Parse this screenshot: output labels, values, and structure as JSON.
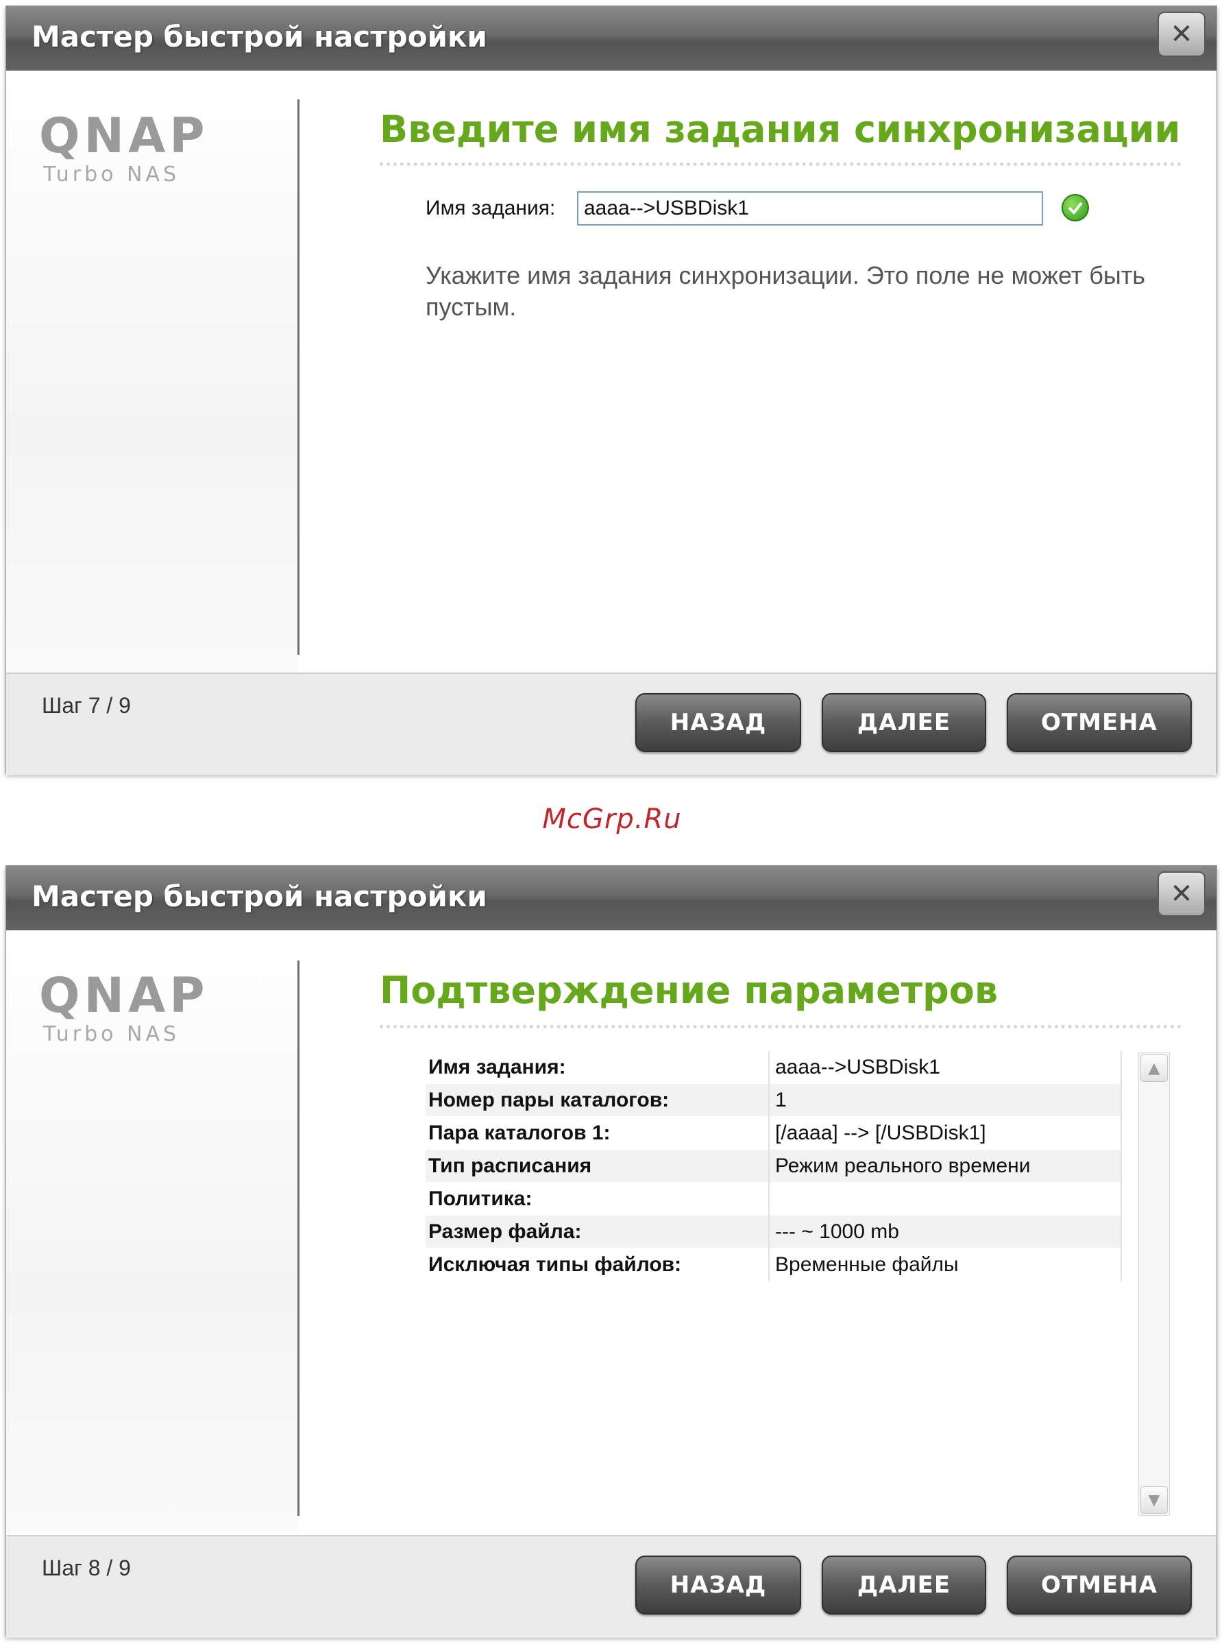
{
  "dialog1": {
    "title": "Мастер быстрой настройки",
    "close_glyph": "✕",
    "logo": {
      "main": "QNAP",
      "sub": "Turbo NAS"
    },
    "heading": "Введите имя задания синхронизации",
    "field": {
      "label": "Имя задания:",
      "value": "aaaa-->USBDisk1",
      "status_icon": "check-ok-icon"
    },
    "hint": "Укажите имя задания синхронизации. Это поле не может быть пустым.",
    "step": "Шаг 7 / 9",
    "buttons": {
      "back": "НАЗАД",
      "next": "ДАЛЕЕ",
      "cancel": "ОТМЕНА"
    }
  },
  "watermark": "McGrp.Ru",
  "dialog2": {
    "title": "Мастер быстрой настройки",
    "close_glyph": "✕",
    "logo": {
      "main": "QNAP",
      "sub": "Turbo NAS"
    },
    "heading": "Подтверждение параметров",
    "params": [
      {
        "key": "Имя задания:",
        "value": "aaaa-->USBDisk1"
      },
      {
        "key": "Номер пары каталогов:",
        "value": "1"
      },
      {
        "key": "Пара каталогов 1:",
        "value": "[/aaaa] --> [/USBDisk1]"
      },
      {
        "key": "Тип расписания",
        "value": "Режим реального времени"
      },
      {
        "key": "Политика:",
        "value": ""
      },
      {
        "key": "Размер файла:",
        "value": "--- ~ 1000 mb"
      },
      {
        "key": "Исключая типы файлов:",
        "value": "Временные файлы"
      }
    ],
    "scroll_up_glyph": "▲",
    "scroll_down_glyph": "▼",
    "step": "Шаг 8 / 9",
    "buttons": {
      "back": "НАЗАД",
      "next": "ДАЛЕЕ",
      "cancel": "ОТМЕНА"
    }
  }
}
